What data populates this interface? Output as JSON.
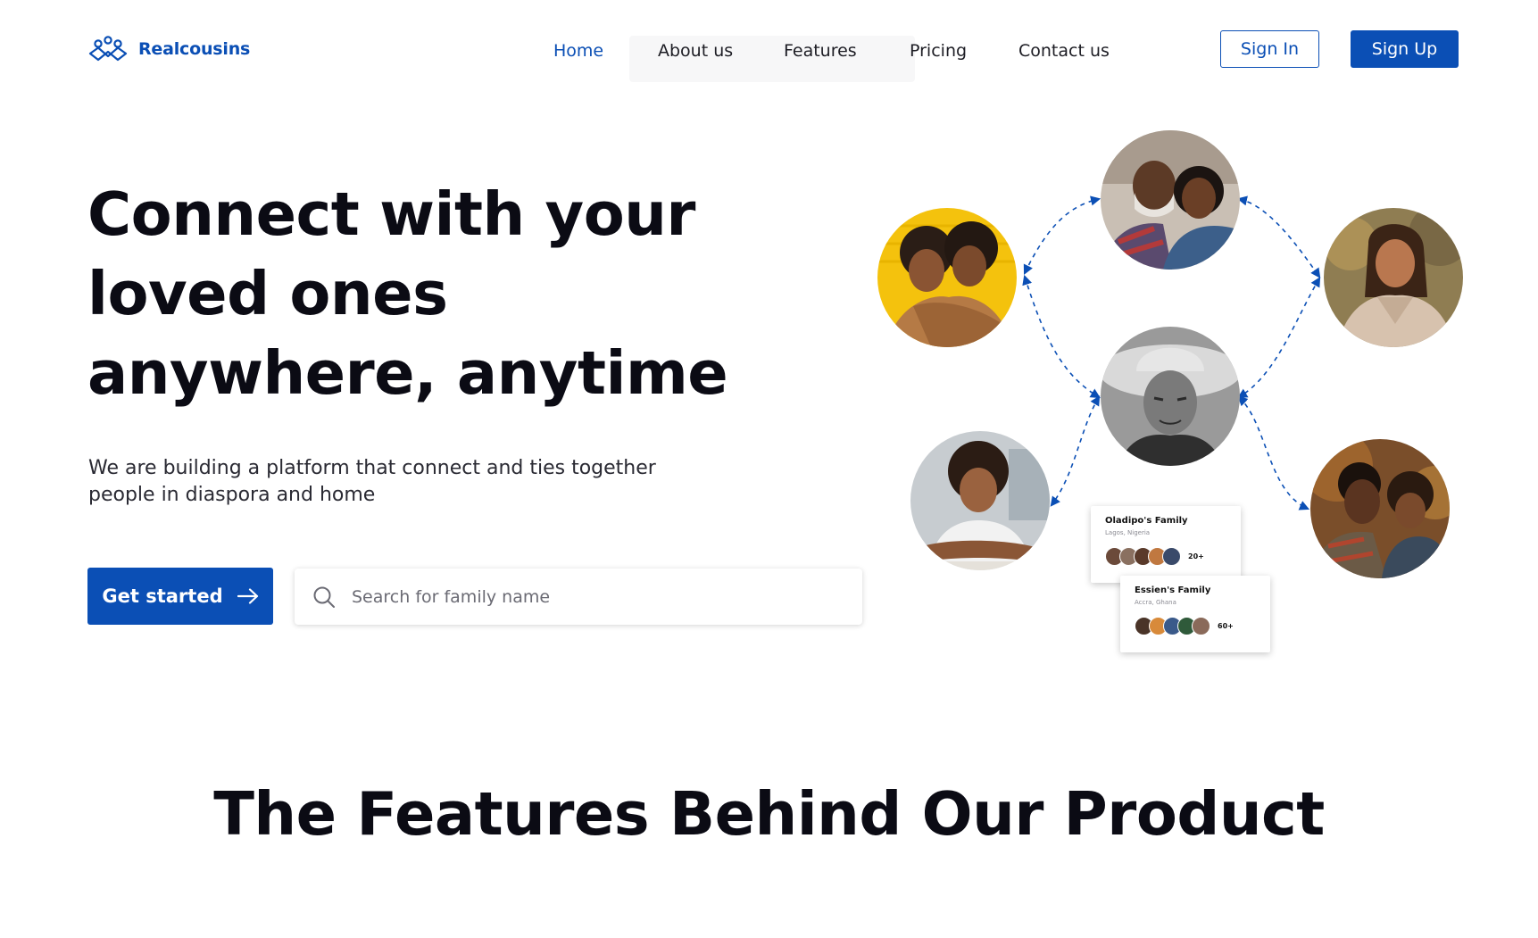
{
  "brand": {
    "name": "Realcousins",
    "logo_icon": "connected-people-icon",
    "color": "#0b4fb5"
  },
  "nav": {
    "items": [
      {
        "label": "Home",
        "active": true
      },
      {
        "label": "About us",
        "active": false
      },
      {
        "label": "Features",
        "active": false
      },
      {
        "label": "Pricing",
        "active": false
      },
      {
        "label": "Contact us",
        "active": false
      }
    ]
  },
  "auth": {
    "signin_label": "Sign In",
    "signup_label": "Sign Up"
  },
  "hero": {
    "title": "Connect with your loved ones anywhere, anytime",
    "subtitle": "We are building a platform that connect and ties together people in diaspora and home",
    "cta_label": "Get started",
    "cta_icon": "arrow-right-icon",
    "search_placeholder": "Search for family name",
    "search_icon": "search-icon"
  },
  "family_cards": [
    {
      "name": "Oladipo's Family",
      "location": "Lagos, Nigeria",
      "count": "20+"
    },
    {
      "name": "Essien's Family",
      "location": "Accra, Ghana",
      "count": "60+"
    }
  ],
  "features": {
    "title": "The Features Behind Our Product"
  }
}
